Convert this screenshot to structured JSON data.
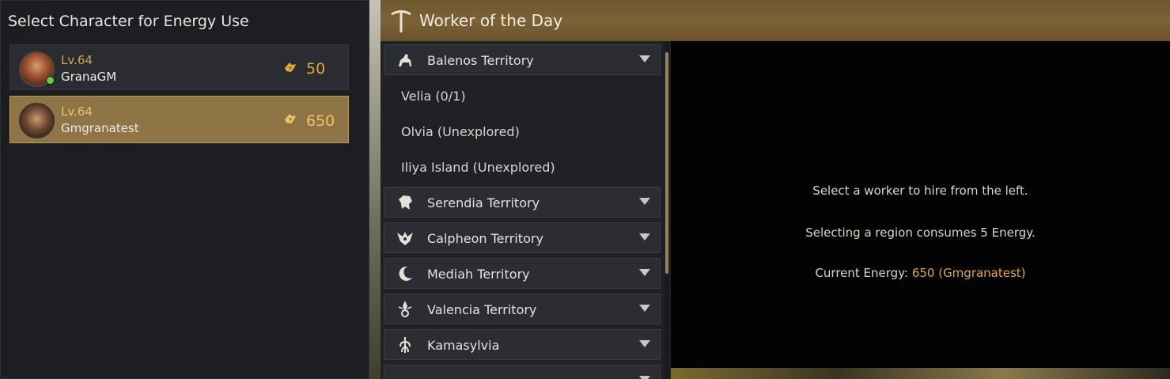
{
  "character_panel": {
    "title": "Select Character for Energy Use",
    "characters": [
      {
        "level": "Lv.64",
        "name": "GranaGM",
        "energy": "50",
        "online": true,
        "selected": false
      },
      {
        "level": "Lv.64",
        "name": "Gmgranatest",
        "energy": "650",
        "online": false,
        "selected": true
      }
    ]
  },
  "worker_panel": {
    "title": "Worker of the Day",
    "regions": [
      {
        "label": "Balenos Territory",
        "icon": "horse-icon",
        "expanded": true,
        "cities": [
          "Velia (0/1)",
          "Olvia (Unexplored)",
          "Iliya Island (Unexplored)"
        ]
      },
      {
        "label": "Serendia Territory",
        "icon": "lion-head-icon"
      },
      {
        "label": "Calpheon Territory",
        "icon": "eagle-crest-icon"
      },
      {
        "label": "Mediah Territory",
        "icon": "crescent-moon-icon"
      },
      {
        "label": "Valencia Territory",
        "icon": "sun-emblem-icon"
      },
      {
        "label": "Kamasylvia",
        "icon": "tree-emblem-icon"
      }
    ],
    "info": {
      "line1": "Select a worker to hire from the left.",
      "line2": "Selecting a region consumes 5 Energy.",
      "line3_prefix": "Current Energy: ",
      "line3_value": "650 (Gmgranatest)"
    }
  },
  "colors": {
    "accent_gold": "#e0a92f",
    "header_brown": "#7c6236",
    "selected_row": "#8f7445"
  }
}
